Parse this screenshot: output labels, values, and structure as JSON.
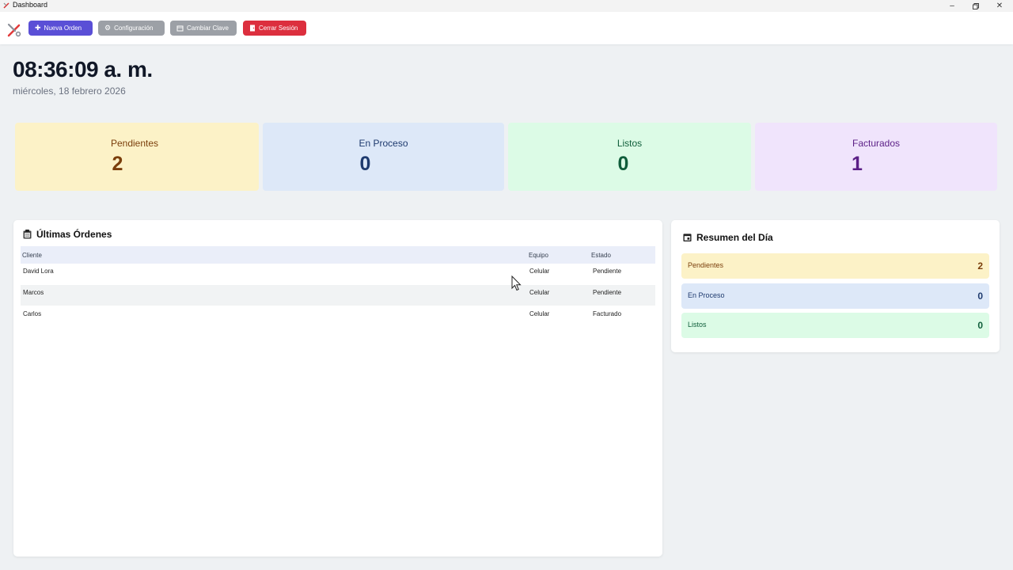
{
  "window": {
    "title": "Dashboard",
    "controls": [
      "minimize",
      "maximize",
      "close"
    ]
  },
  "toolbar": {
    "buttons": [
      {
        "label": "Nueva Orden",
        "icon": "plus-icon",
        "color": "#5a4fd6"
      },
      {
        "label": "Configuración",
        "icon": "gear-icon",
        "color": "#9ca0a6"
      },
      {
        "label": "Cambiar Clave",
        "icon": "key-icon",
        "color": "#9ca0a6"
      },
      {
        "label": "Cerrar Sesión",
        "icon": "logout-icon",
        "color": "#dc2f3e"
      }
    ]
  },
  "clock": {
    "time": "08:36:09 a. m.",
    "date": "miércoles, 18 febrero 2026"
  },
  "stats": [
    {
      "label": "Pendientes",
      "value": "2",
      "color": "#fcf2c7"
    },
    {
      "label": "En Proceso",
      "value": "0",
      "color": "#dde8f8"
    },
    {
      "label": "Listos",
      "value": "0",
      "color": "#dcfbe6"
    },
    {
      "label": "Facturados",
      "value": "1",
      "color": "#f0e4fc"
    }
  ],
  "orders": {
    "title": "Últimas Órdenes",
    "icon": "clipboard-icon",
    "columns": [
      "Cliente",
      "Equipo",
      "Estado"
    ],
    "rows": [
      {
        "cliente": "David Lora",
        "equipo": "Celular",
        "estado": "Pendiente"
      },
      {
        "cliente": "Marcos",
        "equipo": "Celular",
        "estado": "Pendiente"
      },
      {
        "cliente": "Carlos",
        "equipo": "Celular",
        "estado": "Facturado"
      }
    ]
  },
  "summary": {
    "title": "Resumen del Día",
    "icon": "calendar-icon",
    "items": [
      {
        "label": "Pendientes",
        "value": "2"
      },
      {
        "label": "En Proceso",
        "value": "0"
      },
      {
        "label": "Listos",
        "value": "0"
      }
    ]
  }
}
